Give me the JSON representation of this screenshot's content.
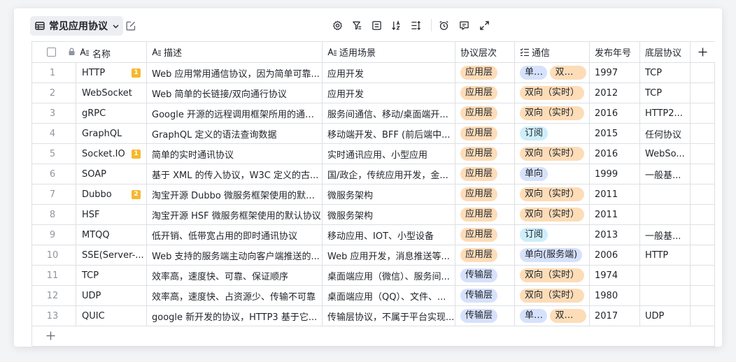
{
  "view": {
    "title": "常见应用协议"
  },
  "columns": {
    "name": "名称",
    "desc": "描述",
    "scene": "适用场景",
    "layer": "协议层次",
    "comm": "通信",
    "year": "发布年号",
    "proto": "底层协议"
  },
  "rows": [
    {
      "num": "1",
      "name": "HTTP",
      "badge": "1",
      "desc": "Web 应用常用通信协议，因为简单可靠...",
      "scene": "应用开发",
      "layer": "应用层",
      "layer_type": "app",
      "comm": [
        {
          "label": "单向",
          "type": "single"
        },
        {
          "label": "双向...",
          "type": "dual",
          "clip": true
        }
      ],
      "year": "1997",
      "proto": "TCP"
    },
    {
      "num": "2",
      "name": "WebSocket",
      "badge": "",
      "desc": "Web 简单的长链接/双向通行协议",
      "scene": "应用开发",
      "layer": "应用层",
      "layer_type": "app",
      "comm": [
        {
          "label": "双向（实时）",
          "type": "dual"
        }
      ],
      "year": "2012",
      "proto": "TCP"
    },
    {
      "num": "3",
      "name": "gRPC",
      "badge": "",
      "desc": "Google 开源的远程调用框架所用的通信...",
      "scene": "服务间通信、移动/桌面端开...",
      "layer": "应用层",
      "layer_type": "app",
      "comm": [
        {
          "label": "双向（实时）",
          "type": "dual"
        }
      ],
      "year": "2016",
      "proto": "HTTP2..."
    },
    {
      "num": "4",
      "name": "GraphQL",
      "badge": "",
      "desc": "GraphQL 定义的语法查询数据",
      "scene": "移动端开发、BFF (前后端中...",
      "layer": "应用层",
      "layer_type": "app",
      "comm": [
        {
          "label": "订阅",
          "type": "sub"
        }
      ],
      "year": "2015",
      "proto": "任何协议"
    },
    {
      "num": "5",
      "name": "Socket.IO",
      "badge": "1",
      "desc": "简单的实时通讯协议",
      "scene": "实时通讯应用、小型应用",
      "layer": "应用层",
      "layer_type": "app",
      "comm": [
        {
          "label": "双向（实时）",
          "type": "dual"
        }
      ],
      "year": "2016",
      "proto": "WebSo..."
    },
    {
      "num": "6",
      "name": "SOAP",
      "badge": "",
      "desc": "基于 XML 的传入协议，W3C 定义的古...",
      "scene": "国/政企，传统应用开发，金...",
      "layer": "应用层",
      "layer_type": "app",
      "comm": [
        {
          "label": "单向",
          "type": "single"
        }
      ],
      "year": "1999",
      "proto": "一般基..."
    },
    {
      "num": "7",
      "name": "Dubbo",
      "badge": "2",
      "desc": "淘宝开源 Dubbo 微服务框架使用的默认...",
      "scene": "微服务架构",
      "layer": "应用层",
      "layer_type": "app",
      "comm": [
        {
          "label": "双向（实时）",
          "type": "dual"
        }
      ],
      "year": "2011",
      "proto": ""
    },
    {
      "num": "8",
      "name": "HSF",
      "badge": "",
      "desc": "淘宝开源 HSF 微服务框架使用的默认协议",
      "scene": "微服务架构",
      "layer": "应用层",
      "layer_type": "app",
      "comm": [
        {
          "label": "双向（实时）",
          "type": "dual"
        }
      ],
      "year": "2011",
      "proto": ""
    },
    {
      "num": "9",
      "name": "MTQQ",
      "badge": "",
      "desc": "低开销、低带宽占用的即时通讯协议",
      "scene": "移动应用、IOT、小型设备",
      "layer": "应用层",
      "layer_type": "app",
      "comm": [
        {
          "label": "订阅",
          "type": "sub"
        }
      ],
      "year": "2013",
      "proto": "一般基..."
    },
    {
      "num": "10",
      "name": "SSE(Server-...",
      "badge": "",
      "desc": "Web 支持的服务端主动向客户端推送的...",
      "scene": "Web 应用开发，消息推送等...",
      "layer": "应用层",
      "layer_type": "app",
      "comm": [
        {
          "label": "单向(服务端)",
          "type": "single"
        }
      ],
      "year": "2006",
      "proto": "HTTP"
    },
    {
      "num": "11",
      "name": "TCP",
      "badge": "",
      "desc": "效率高，速度快、可靠、保证顺序",
      "scene": "桌面端应用（微信）、服务间...",
      "layer": "传输层",
      "layer_type": "trans",
      "comm": [
        {
          "label": "双向（实时）",
          "type": "dual"
        }
      ],
      "year": "1974",
      "proto": ""
    },
    {
      "num": "12",
      "name": "UDP",
      "badge": "",
      "desc": "效率高，速度快、占资源少、传输不可靠",
      "scene": "桌面端应用（QQ）、文件、...",
      "layer": "传输层",
      "layer_type": "trans",
      "comm": [
        {
          "label": "双向（实时）",
          "type": "dual"
        }
      ],
      "year": "1980",
      "proto": ""
    },
    {
      "num": "13",
      "name": "QUIC",
      "badge": "",
      "desc": "google 新开发的协议，HTTP3 基于它...",
      "scene": "传输层协议，不属于平台实现...",
      "layer": "传输层",
      "layer_type": "trans",
      "comm": [
        {
          "label": "单向",
          "type": "single"
        },
        {
          "label": "双向...",
          "type": "dual",
          "clip": true
        }
      ],
      "year": "2017",
      "proto": "UDP"
    }
  ],
  "colors": {
    "app_tag": "#fddcb8",
    "trans_tag": "#d6e1fb",
    "sub_tag": "#cdeefa",
    "badge": "#f5b82e"
  }
}
